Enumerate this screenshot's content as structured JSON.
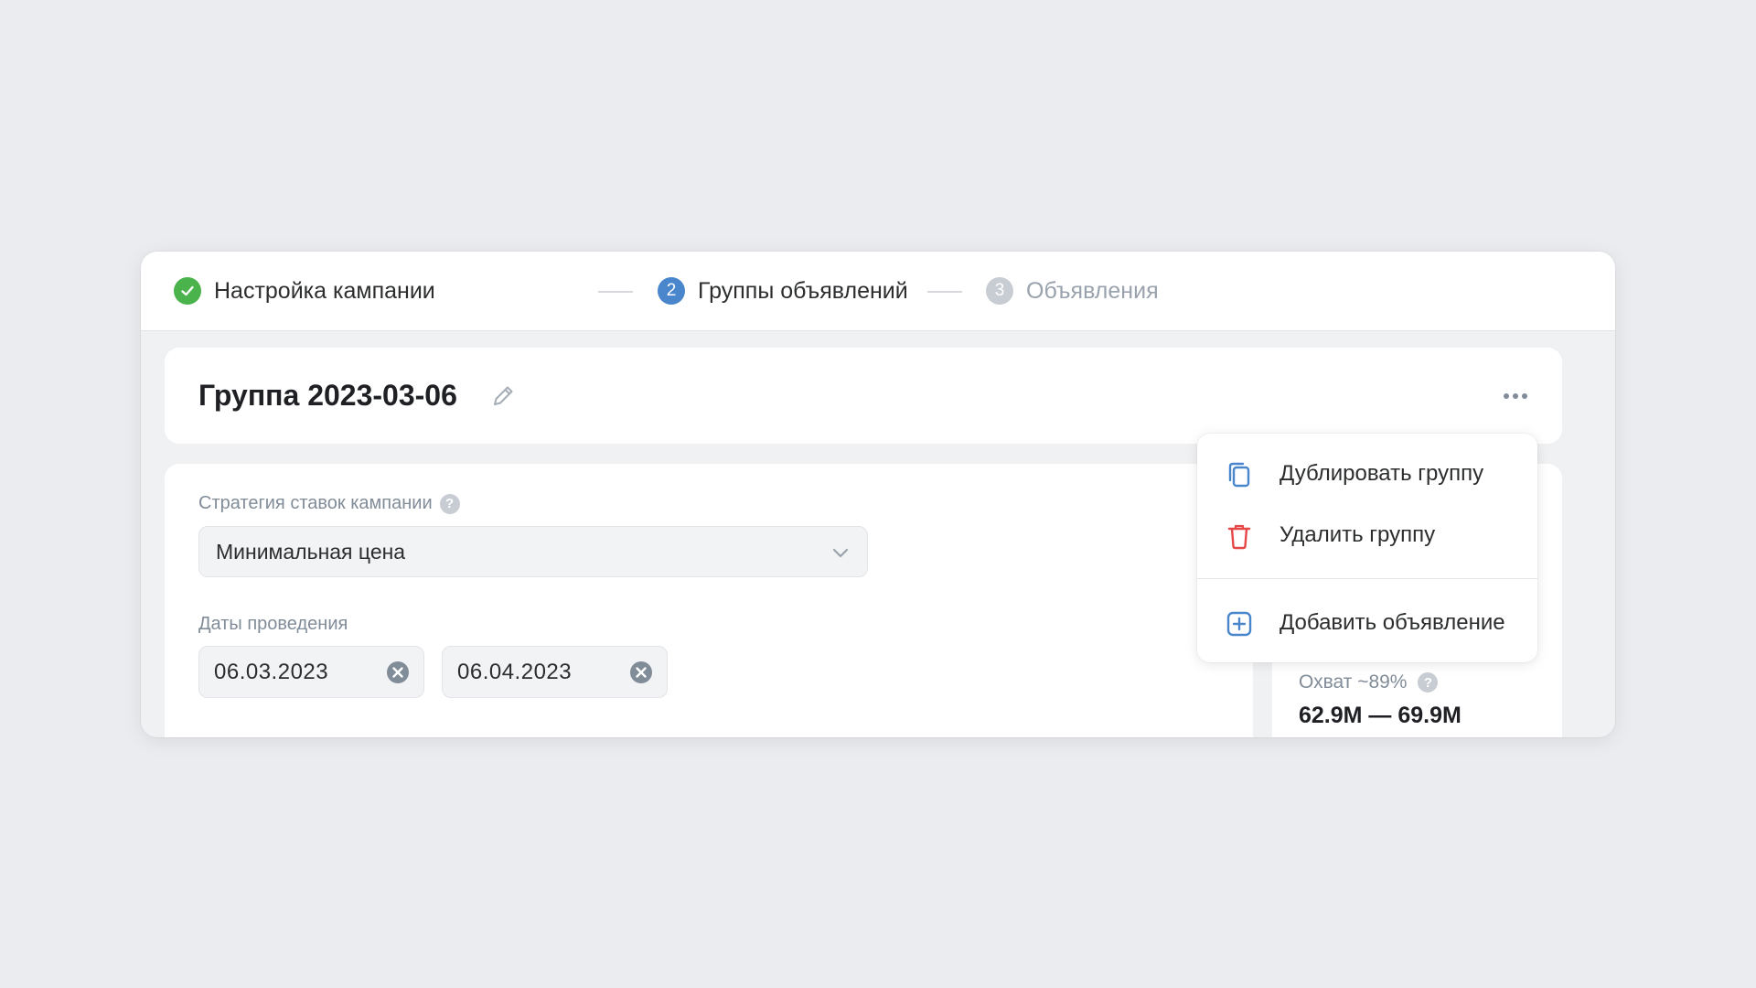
{
  "stepper": {
    "steps": [
      {
        "number": "",
        "label": "Настройка кампании",
        "state": "done"
      },
      {
        "number": "2",
        "label": "Группы объявлений",
        "state": "active"
      },
      {
        "number": "3",
        "label": "Объявления",
        "state": "pending"
      }
    ]
  },
  "group": {
    "title": "Группа 2023-03-06"
  },
  "form": {
    "strategy_label": "Стратегия ставок кампании",
    "strategy_help": "?",
    "strategy_value": "Минимальная цена",
    "dates_label": "Даты проведения",
    "date_start": "06.03.2023",
    "date_end": "06.04.2023"
  },
  "menu": {
    "items": [
      {
        "label": "Дублировать группу",
        "icon": "duplicate-icon"
      },
      {
        "label": "Удалить группу",
        "icon": "trash-icon"
      },
      {
        "label": "Добавить объявление",
        "icon": "add-square-icon"
      }
    ]
  },
  "reach": {
    "label": "Охват ~89%",
    "help": "?",
    "value": "62.9M — 69.9M"
  },
  "colors": {
    "page_bg": "#ebecef",
    "accent_blue": "#4986cc",
    "success_green": "#4bb34b",
    "danger_red": "#e64646",
    "muted": "#818c99"
  }
}
